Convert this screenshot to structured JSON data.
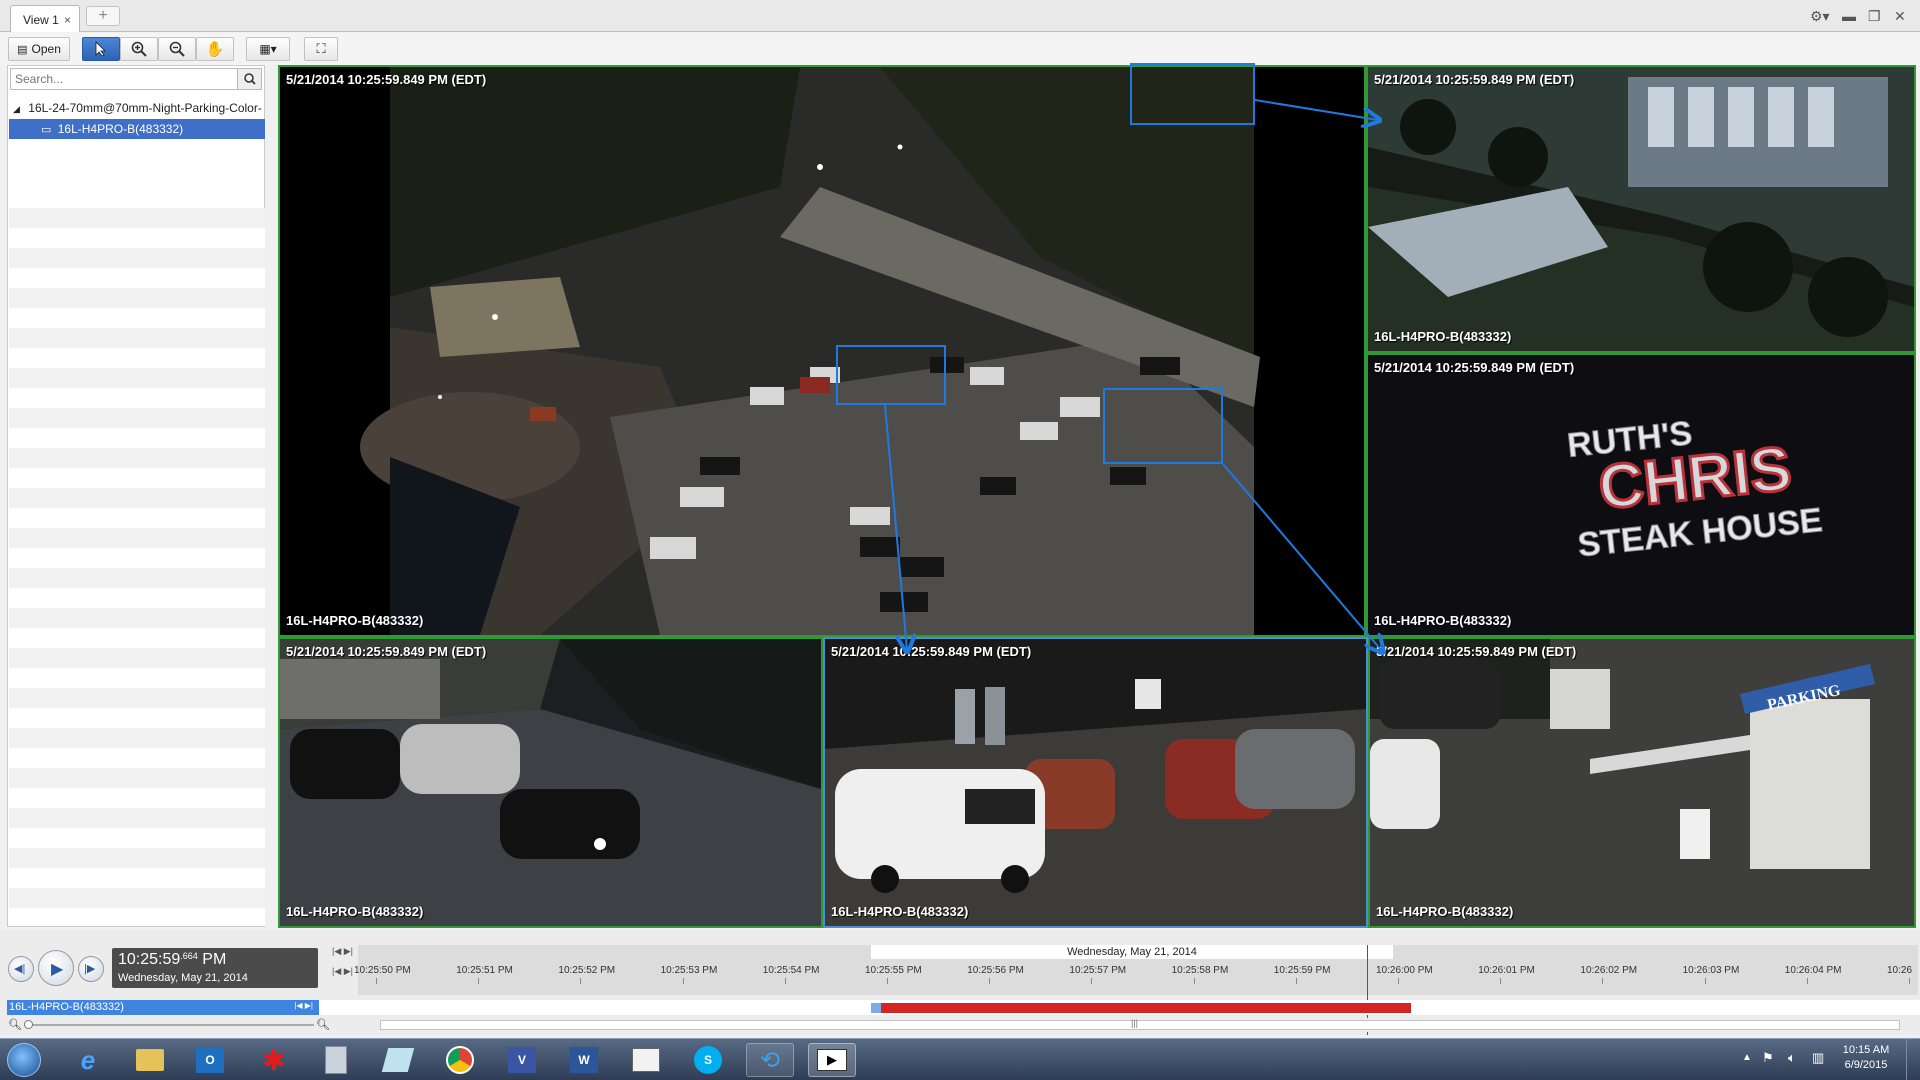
{
  "tabs": [
    {
      "label": "View 1",
      "close": "×"
    }
  ],
  "new_tab": "+",
  "toolbar": {
    "open_label": "Open"
  },
  "search": {
    "placeholder": "Search..."
  },
  "tree": {
    "camera_group": "16L-24-70mm@70mm-Night-Parking-Color-",
    "camera_item": "16L-H4PRO-B(483332)"
  },
  "tiles": [
    {
      "timestamp": "5/21/2014 10:25:59.849 PM (EDT)",
      "label": "16L-H4PRO-B(483332)"
    },
    {
      "timestamp": "5/21/2014 10:25:59.849 PM (EDT)",
      "label": "16L-H4PRO-B(483332)"
    },
    {
      "timestamp": "5/21/2014 10:25:59.849 PM (EDT)",
      "label": "16L-H4PRO-B(483332)"
    },
    {
      "timestamp": "5/21/2014 10:25:59.849 PM (EDT)",
      "label": "16L-H4PRO-B(483332)"
    },
    {
      "timestamp": "5/21/2014 10:25:59.849 PM (EDT)",
      "label": "16L-H4PRO-B(483332)"
    },
    {
      "timestamp": "5/21/2014 10:25:59.849 PM (EDT)",
      "label": "16L-H4PRO-B(483332)"
    }
  ],
  "sign_text": {
    "line1": "RUTH'S",
    "line2": "CHRIS",
    "line3": "STEAK HOUSE"
  },
  "parking_sign": "PARKING",
  "playback": {
    "time_main": "10:25:59",
    "time_ms": ".664",
    "time_ampm": "PM",
    "date": "Wednesday, May 21, 2014",
    "track_label": "16L-H4PRO-B(483332)"
  },
  "timeline": {
    "date_header": "Wednesday, May 21, 2014",
    "ticks": [
      "10:25:50 PM",
      "10:25:51 PM",
      "10:25:52 PM",
      "10:25:53 PM",
      "10:25:54 PM",
      "10:25:55 PM",
      "10:25:56 PM",
      "10:25:57 PM",
      "10:25:58 PM",
      "10:25:59 PM",
      "10:26:00 PM",
      "10:26:01 PM",
      "10:26:02 PM",
      "10:26:03 PM",
      "10:26:04 PM",
      "10:26"
    ]
  },
  "clock": {
    "time": "10:15 AM",
    "date": "6/9/2015"
  },
  "colors": {
    "tile_border": "#2f9a34",
    "selected_border": "#4a8fd6",
    "recording": "#d42424",
    "selection": "#3f6fc6"
  }
}
